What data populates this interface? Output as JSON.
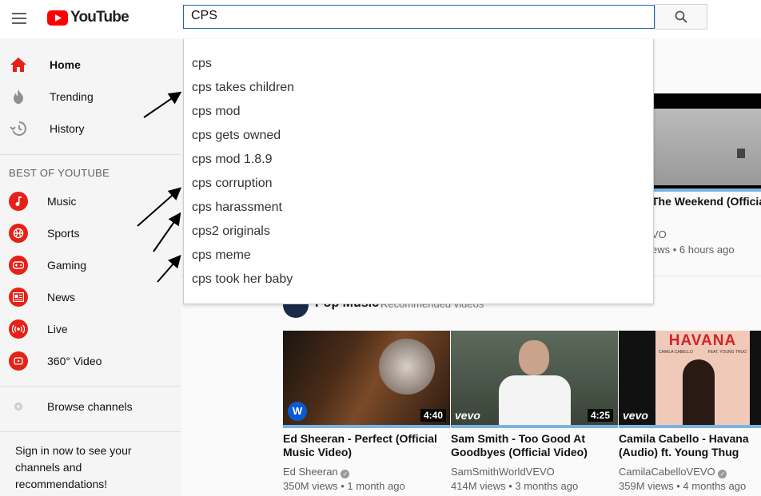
{
  "header": {
    "logo_text": "YouTube",
    "search_value": "CPS"
  },
  "sidebar": {
    "items": [
      {
        "label": "Home",
        "icon": "home-icon"
      },
      {
        "label": "Trending",
        "icon": "trending-icon"
      },
      {
        "label": "History",
        "icon": "history-icon"
      }
    ],
    "section_heading": "BEST OF YOUTUBE",
    "best": [
      {
        "label": "Music",
        "icon": "music-icon"
      },
      {
        "label": "Sports",
        "icon": "sports-icon"
      },
      {
        "label": "Gaming",
        "icon": "gaming-icon"
      },
      {
        "label": "News",
        "icon": "news-icon"
      },
      {
        "label": "Live",
        "icon": "live-icon"
      },
      {
        "label": "360° Video",
        "icon": "360-video-icon"
      }
    ],
    "browse_label": "Browse channels",
    "signin_text": "Sign in now to see your channels and recommendations!"
  },
  "suggestions": [
    "cps",
    "cps takes children",
    "cps mod",
    "cps gets owned",
    "cps mod 1.8.9",
    "cps corruption",
    "cps harassment",
    "cps2 originals",
    "cps meme",
    "cps took her baby"
  ],
  "top_video": {
    "title_fragment": "The Weekend (Official",
    "channel_fragment": "VO",
    "meta_fragment": "ews • 6 hours ago"
  },
  "section": {
    "title": "Pop Music",
    "subtitle": "Recommended videos"
  },
  "videos": [
    {
      "title": "Ed Sheeran - Perfect (Official Music Video)",
      "channel": "Ed Sheeran",
      "meta": "350M views • 1 month ago",
      "duration": "4:40"
    },
    {
      "title": "Sam Smith - Too Good At Goodbyes (Official Video)",
      "channel": "SamSmithWorldVEVO",
      "meta": "414M views • 3 months ago",
      "duration": "4:25",
      "badge": "vevo"
    },
    {
      "title": "Camila Cabello - Havana (Audio) ft. Young Thug",
      "channel": "CamilaCabelloVEVO",
      "meta": "359M views • 4 months ago",
      "badge": "vevo",
      "thumb_title": "HAVANA",
      "thumb_sub_left": "CAMILA CABELLO",
      "thumb_sub_right": "FEAT. YOUNG THUG"
    }
  ],
  "colors": {
    "brand_red": "#ff0000",
    "icon_red": "#e62117",
    "search_border": "#1c62b9"
  }
}
